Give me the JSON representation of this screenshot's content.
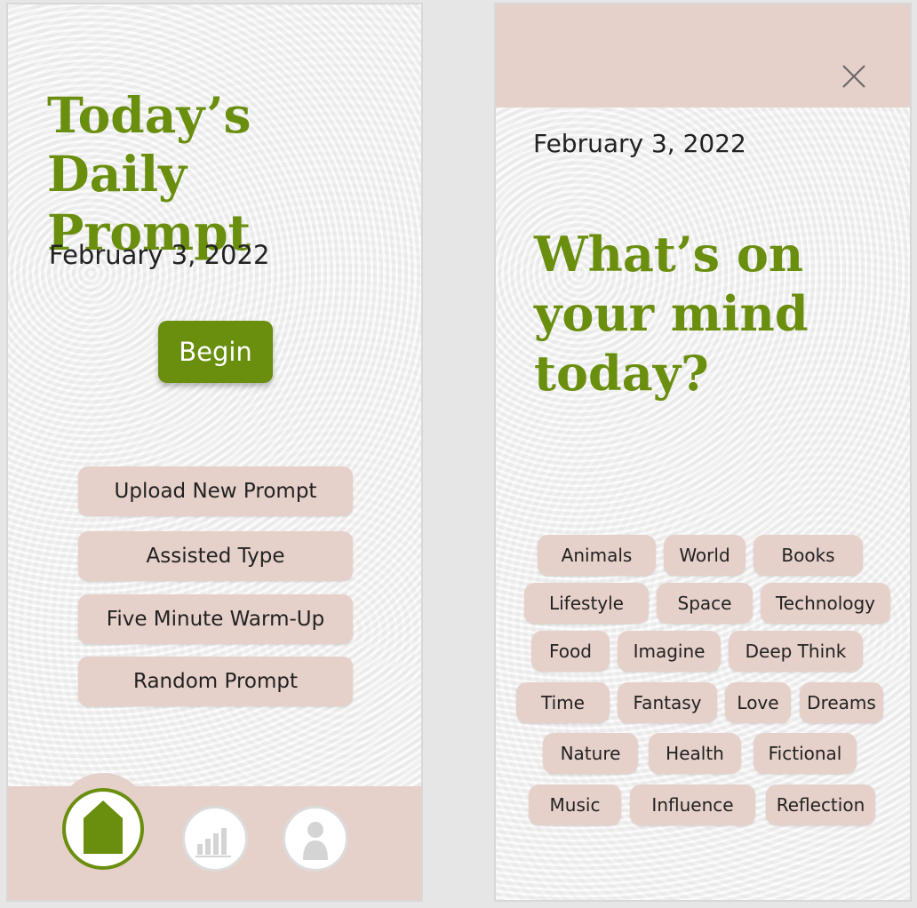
{
  "left_screen": {
    "title": "Today’s Daily Prompt",
    "date": "February 3, 2022",
    "begin_label": "Begin",
    "options": [
      "Upload New Prompt",
      "Assisted Type",
      "Five Minute Warm-Up",
      "Random Prompt"
    ],
    "nav": {
      "icons": [
        "home-icon",
        "stats-icon",
        "profile-icon"
      ],
      "active": "home"
    }
  },
  "right_screen": {
    "date": "February 3, 2022",
    "title": "What’s on your mind today?",
    "close_icon": "close-icon",
    "topics": [
      "Animals",
      "World",
      "Books",
      "Lifestyle",
      "Space",
      "Technology",
      "Food",
      "Imagine",
      "Deep Think",
      "Time",
      "Fantasy",
      "Love",
      "Dreams",
      "Nature",
      "Health",
      "Fictional",
      "Music",
      "Influence",
      "Reflection"
    ]
  },
  "colors": {
    "accent": "#6a8e0e",
    "chip": "#e6d0ca",
    "text": "#222222"
  }
}
